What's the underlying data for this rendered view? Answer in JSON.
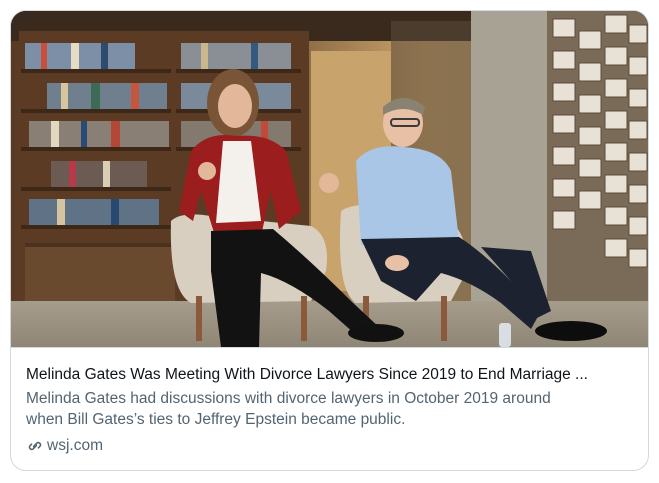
{
  "card": {
    "title": "Melinda Gates Was Meeting With Divorce Lawyers Since 2019 to End Marriage ...",
    "description_line1": "Melinda Gates had discussions with divorce lawyers in October 2019 around",
    "description_line2": "when Bill Gates’s ties to Jeffrey Epstein became public.",
    "domain": "wsj.com",
    "image_alt": "Photo of Melinda Gates and Bill Gates seated in chairs in front of bookshelves",
    "link_icon": "link-icon"
  },
  "colors": {
    "title": "#0f1419",
    "secondary": "#536471",
    "border": "#cfd9de"
  }
}
